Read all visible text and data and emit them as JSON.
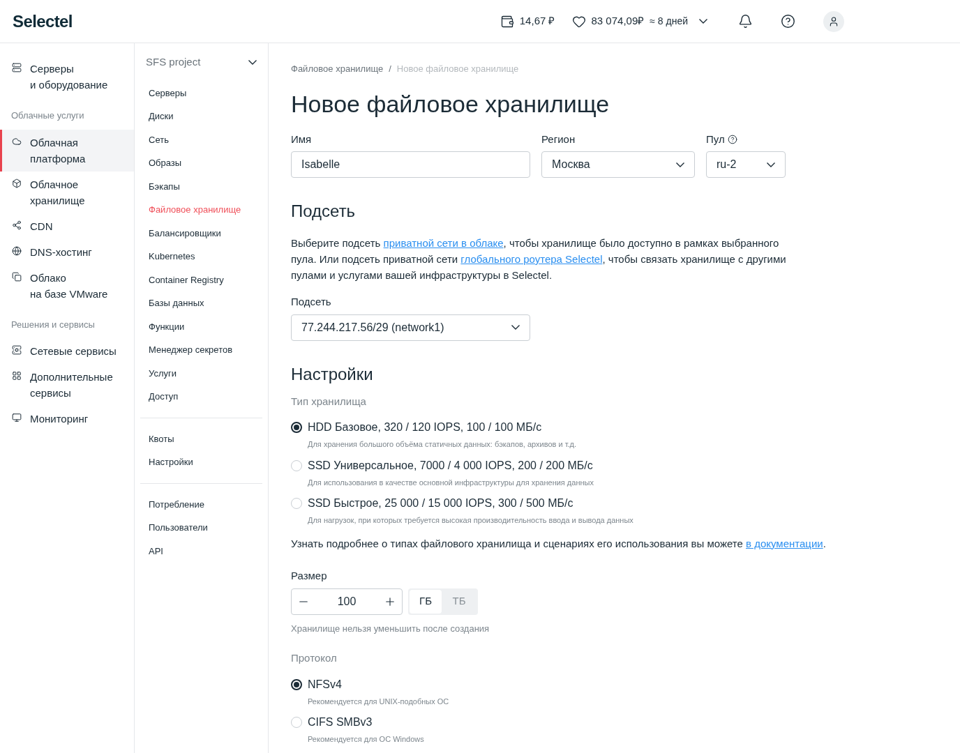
{
  "header": {
    "logo": "Selectel",
    "balance": "14,67 ₽",
    "bonus": "83 074,09₽",
    "days": "≈ 8 дней"
  },
  "sidebar": [
    {
      "kind": "item",
      "label": "Серверы\nи оборудование",
      "selected": false
    },
    {
      "kind": "section",
      "label": "Облачные услуги"
    },
    {
      "kind": "item",
      "label": "Облачная\nплатформа",
      "selected": true
    },
    {
      "kind": "item",
      "label": "Облачное\nхранилище",
      "selected": false
    },
    {
      "kind": "item",
      "label": "CDN",
      "selected": false
    },
    {
      "kind": "item",
      "label": "DNS-хостинг",
      "selected": false
    },
    {
      "kind": "item",
      "label": "Облако\nна базе VMware",
      "selected": false
    },
    {
      "kind": "section",
      "label": "Решения и сервисы"
    },
    {
      "kind": "item",
      "label": "Сетевые сервисы",
      "selected": false
    },
    {
      "kind": "item",
      "label": "Дополнительные\nсервисы",
      "selected": false
    },
    {
      "kind": "item",
      "label": "Мониторинг",
      "selected": false
    }
  ],
  "subnav": {
    "project": "SFS project",
    "groups": [
      [
        {
          "label": "Серверы",
          "selected": false
        },
        {
          "label": "Диски",
          "selected": false
        },
        {
          "label": "Сеть",
          "selected": false
        },
        {
          "label": "Образы",
          "selected": false
        },
        {
          "label": "Бэкапы",
          "selected": false
        },
        {
          "label": "Файловое хранилище",
          "selected": true
        },
        {
          "label": "Балансировщики",
          "selected": false
        },
        {
          "label": "Kubernetes",
          "selected": false
        },
        {
          "label": "Container Registry",
          "selected": false
        },
        {
          "label": "Базы данных",
          "selected": false
        },
        {
          "label": "Функции",
          "selected": false
        },
        {
          "label": "Менеджер секретов",
          "selected": false
        },
        {
          "label": "Услуги",
          "selected": false
        },
        {
          "label": "Доступ",
          "selected": false
        }
      ],
      [
        {
          "label": "Квоты",
          "selected": false
        },
        {
          "label": "Настройки",
          "selected": false
        }
      ],
      [
        {
          "label": "Потребление",
          "selected": false
        },
        {
          "label": "Пользователи",
          "selected": false
        },
        {
          "label": "API",
          "selected": false
        }
      ]
    ]
  },
  "breadcrumb": {
    "separator": "/",
    "items": [
      "Файловое хранилище",
      "Новое файловое хранилище"
    ]
  },
  "title": "Новое файловое хранилище",
  "fields": [
    {
      "kind": "input",
      "label": "Имя",
      "value": "Isabelle"
    },
    {
      "kind": "select",
      "label": "Регион",
      "value": "Москва"
    },
    {
      "kind": "select",
      "label": "Пул",
      "value": "ru-2",
      "help": true
    }
  ],
  "subnet": {
    "heading": "Подсеть",
    "text": [
      {
        "kind": "text",
        "text": "Выберите подсеть "
      },
      {
        "kind": "link",
        "text": "приватной сети в облаке"
      },
      {
        "kind": "text",
        "text": ", чтобы хранилище было доступно в рамках выбранного пула. Или подсеть приватной сети "
      },
      {
        "kind": "link",
        "text": "глобального роутера Selectel"
      },
      {
        "kind": "text",
        "text": ", чтобы связать хранилище с другими пулами и услугами вашей инфраструктуры в Selectel."
      }
    ],
    "label": "Подсеть",
    "value": "77.244.217.56/29 (network1)"
  },
  "settings": {
    "heading": "Настройки",
    "type_label": "Тип хранилища",
    "types": [
      {
        "label": "HDD Базовое, 320 / 120 IOPS, 100 / 100 МБ/с",
        "hint": "Для хранения большого объёма статичных данных: бэкапов, архивов и т.д.",
        "selected": true
      },
      {
        "label": "SSD Универсальное, 7000 / 4 000 IOPS, 200 / 200 МБ/с",
        "hint": "Для использования в качестве основной инфраструктуры для хранения данных",
        "selected": false
      },
      {
        "label": "SSD Быстрое, 25 000 / 15 000 IOPS, 300 / 500 МБ/с",
        "hint": "Для нагрузок, при которых требуется высокая производительность ввода и вывода данных",
        "selected": false
      }
    ],
    "doc_text": "Узнать подробнее о типах файлового хранилища и сценариях его использования вы можете ",
    "doc_link": "в документации",
    "doc_end": ".",
    "size_label": "Размер",
    "size": "100",
    "units": [
      {
        "label": "ГБ",
        "selected": true
      },
      {
        "label": "ТБ",
        "selected": false
      }
    ],
    "size_hint": "Хранилище нельзя уменьшить после создания",
    "protocol_label": "Протокол",
    "protocols": [
      {
        "label": "NFSv4",
        "hint": "Рекомендуется для UNIX-подобных ОС",
        "selected": true
      },
      {
        "label": "CIFS SMBv3",
        "hint": "Рекомендуется для ОС Windows",
        "selected": false
      }
    ]
  }
}
